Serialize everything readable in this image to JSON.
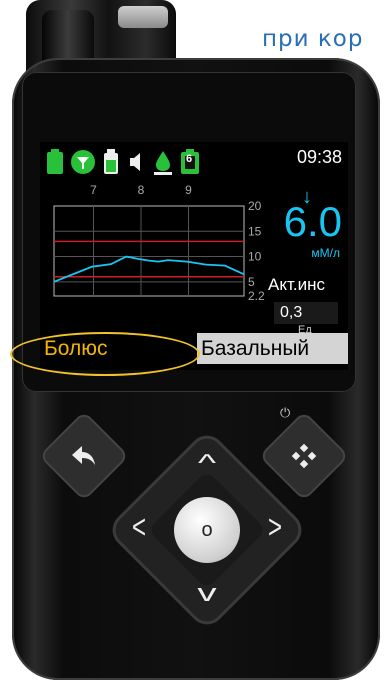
{
  "caption": {
    "line_top": "",
    "line": "при кор"
  },
  "status": {
    "time": "09:38",
    "battery_level": "6",
    "icons": [
      "battery-icon",
      "filter-icon",
      "reservoir-icon",
      "speaker-icon",
      "drop-icon",
      "pump-battery-icon"
    ]
  },
  "chart_data": {
    "type": "line",
    "title": "",
    "xlabel": "",
    "ylabel": "",
    "x_ticks": [
      "7",
      "8",
      "9"
    ],
    "y_ticks": [
      "20",
      "15",
      "10",
      "5",
      "2.2"
    ],
    "ylim": [
      2.2,
      20
    ],
    "limits": [
      13,
      6
    ],
    "series": [
      {
        "x": [
          0.0,
          0.1,
          0.2,
          0.3,
          0.38,
          0.45,
          0.5,
          0.55,
          0.6,
          0.7,
          0.8,
          0.9,
          1.0
        ],
        "values": [
          5,
          6.5,
          8,
          8.5,
          10,
          9.5,
          9.2,
          9.0,
          9.3,
          9.0,
          8.4,
          8.2,
          6.5
        ]
      }
    ]
  },
  "reading": {
    "trend_arrow": "↓",
    "value": "6.0",
    "unit": "мМ/л"
  },
  "active_insulin": {
    "label": "Акт.инс",
    "value": "0,3",
    "unit": "Ед"
  },
  "tabs": {
    "bolus": "Болюс",
    "basal": "Базальный"
  },
  "buttons": {
    "back": "back-arrow-icon",
    "menu": "menu-icon",
    "up": "^",
    "down": "v",
    "left": "<",
    "right": ">",
    "center": "o"
  },
  "colors": {
    "accent": "#19c6f2",
    "highlight": "#f2b500",
    "limit_line": "#c8202a"
  }
}
